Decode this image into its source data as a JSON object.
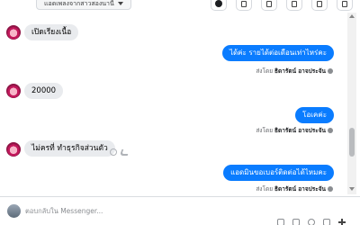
{
  "header": {
    "label_select": "แอดเพลงจากสาวสองนานี้"
  },
  "messages": [
    {
      "dir": "in",
      "text": "เปิดเรียงเนื้อ"
    },
    {
      "dir": "out",
      "text": "ได้ค่ะ รายได้ต่อเดือนเท่าไหร่คะ",
      "sent_prefix": "ส่งโดย",
      "sender": "ธิดารัตน์ อาจประจัน"
    },
    {
      "dir": "in",
      "text": "20000"
    },
    {
      "dir": "out",
      "text": "โอเคค่ะ",
      "sent_prefix": "ส่งโดย",
      "sender": "ธิดารัตน์ อาจประจัน"
    },
    {
      "dir": "in",
      "text": "ไม่ครที่ ทำธุรกิจส่วนตัว"
    },
    {
      "dir": "out",
      "text": "แอดมินขอเบอร์ติดต่อได้ไหมคะ",
      "sent_prefix": "ส่งโดย",
      "sender": "ธิดารัตน์ อาจประจัน"
    }
  ],
  "composer": {
    "placeholder": "ตอบกลับใน Messenger..."
  },
  "colors": {
    "outgoing_bubble": "#0a7cff",
    "incoming_bubble": "#e9ebee"
  }
}
